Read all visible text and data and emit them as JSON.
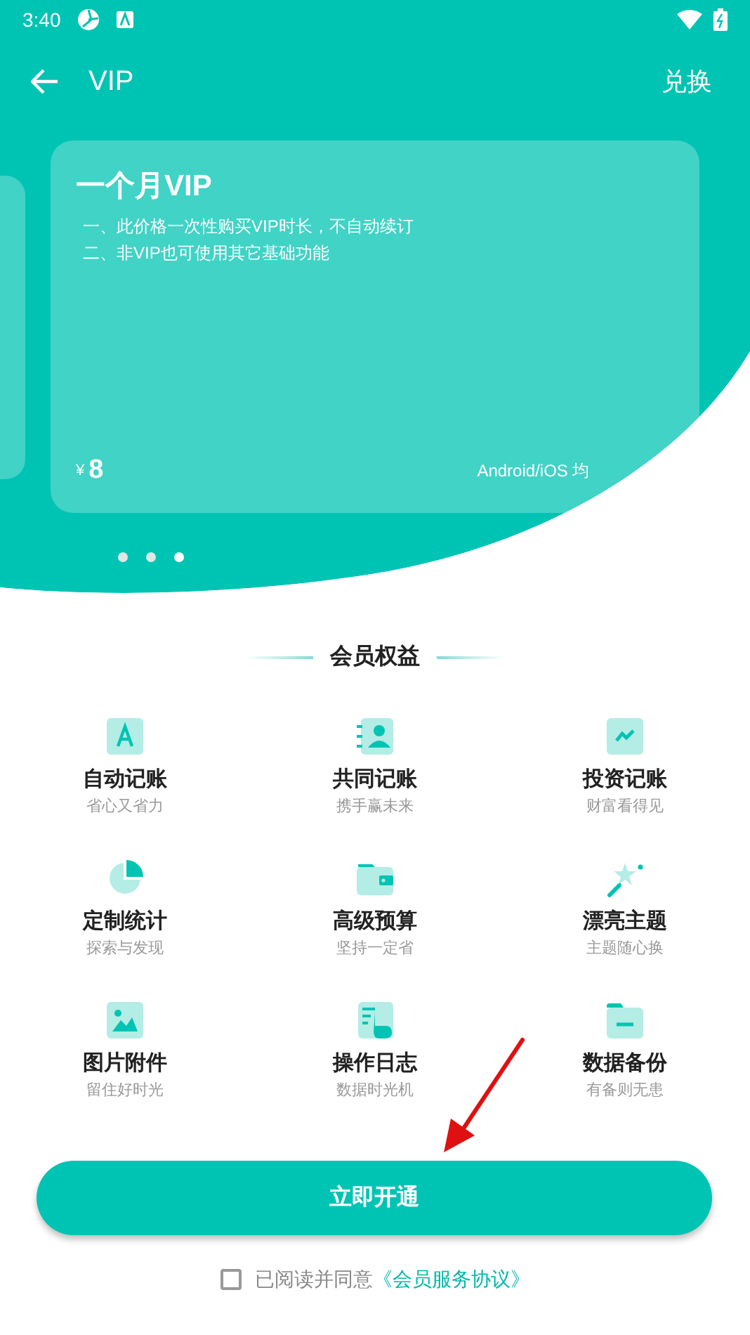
{
  "status_bar": {
    "time": "3:40"
  },
  "toolbar": {
    "title": "VIP",
    "action": "兑换"
  },
  "plan": {
    "title": "一个月VIP",
    "notes": [
      "一、此价格一次性购买VIP时长，不自动续订",
      "二、非VIP也可使用其它基础功能"
    ],
    "currency": "¥",
    "price": "8",
    "platforms": "Android/iOS 均"
  },
  "pager": [
    {
      "selected": false
    },
    {
      "selected": false
    },
    {
      "selected": true
    }
  ],
  "section_title": "会员权益",
  "benefits": [
    {
      "kind": "auto",
      "title": "自动记账",
      "subtitle": "省心又省力"
    },
    {
      "kind": "shared",
      "title": "共同记账",
      "subtitle": "携手赢未来"
    },
    {
      "kind": "invest",
      "title": "投资记账",
      "subtitle": "财富看得见"
    },
    {
      "kind": "stats",
      "title": "定制统计",
      "subtitle": "探索与发现"
    },
    {
      "kind": "budget",
      "title": "高级预算",
      "subtitle": "坚持一定省"
    },
    {
      "kind": "theme",
      "title": "漂亮主题",
      "subtitle": "主题随心换"
    },
    {
      "kind": "image",
      "title": "图片附件",
      "subtitle": "留住好时光"
    },
    {
      "kind": "log",
      "title": "操作日志",
      "subtitle": "数据时光机"
    },
    {
      "kind": "backup",
      "title": "数据备份",
      "subtitle": "有备则无患"
    }
  ],
  "subscribe_button": "立即开通",
  "agreement": {
    "checked": false,
    "text": "已阅读并同意",
    "link": "《会员服务协议》"
  }
}
